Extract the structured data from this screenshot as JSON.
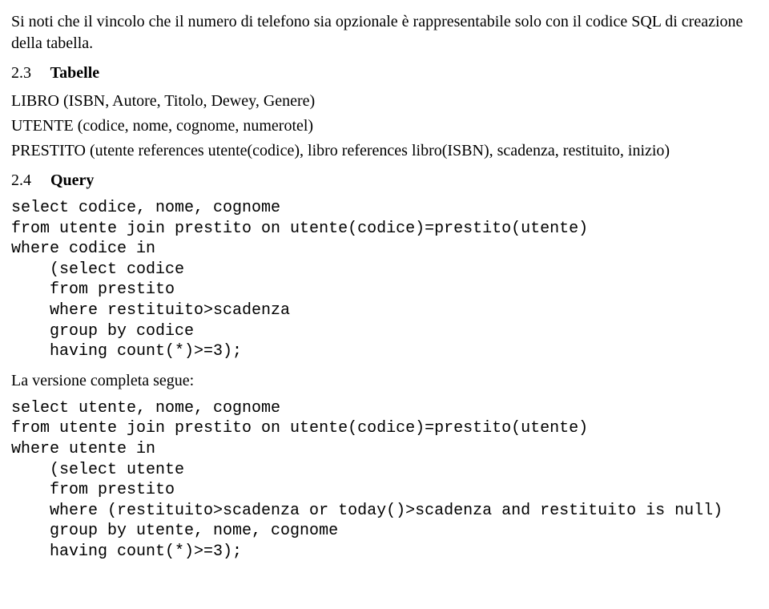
{
  "intro": "Si noti che il vincolo che il numero di telefono sia opzionale è rappresentabile solo con il codice SQL di creazione della tabella.",
  "section_tabelle": {
    "num": "2.3",
    "title": "Tabelle",
    "schemas": [
      "LIBRO (ISBN, Autore, Titolo, Dewey, Genere)",
      "UTENTE (codice, nome, cognome, numerotel)",
      "PRESTITO (utente references utente(codice), libro references libro(ISBN), scadenza, restituito, inizio)"
    ]
  },
  "section_query": {
    "num": "2.4",
    "title": "Query",
    "code1": "select codice, nome, cognome\nfrom utente join prestito on utente(codice)=prestito(utente)\nwhere codice in\n    (select codice\n    from prestito\n    where restituito>scadenza\n    group by codice\n    having count(*)>=3);",
    "between": "La versione completa segue:",
    "code2": "select utente, nome, cognome\nfrom utente join prestito on utente(codice)=prestito(utente)\nwhere utente in\n    (select utente\n    from prestito\n    where (restituito>scadenza or today()>scadenza and restituito is null)\n    group by utente, nome, cognome\n    having count(*)>=3);"
  }
}
